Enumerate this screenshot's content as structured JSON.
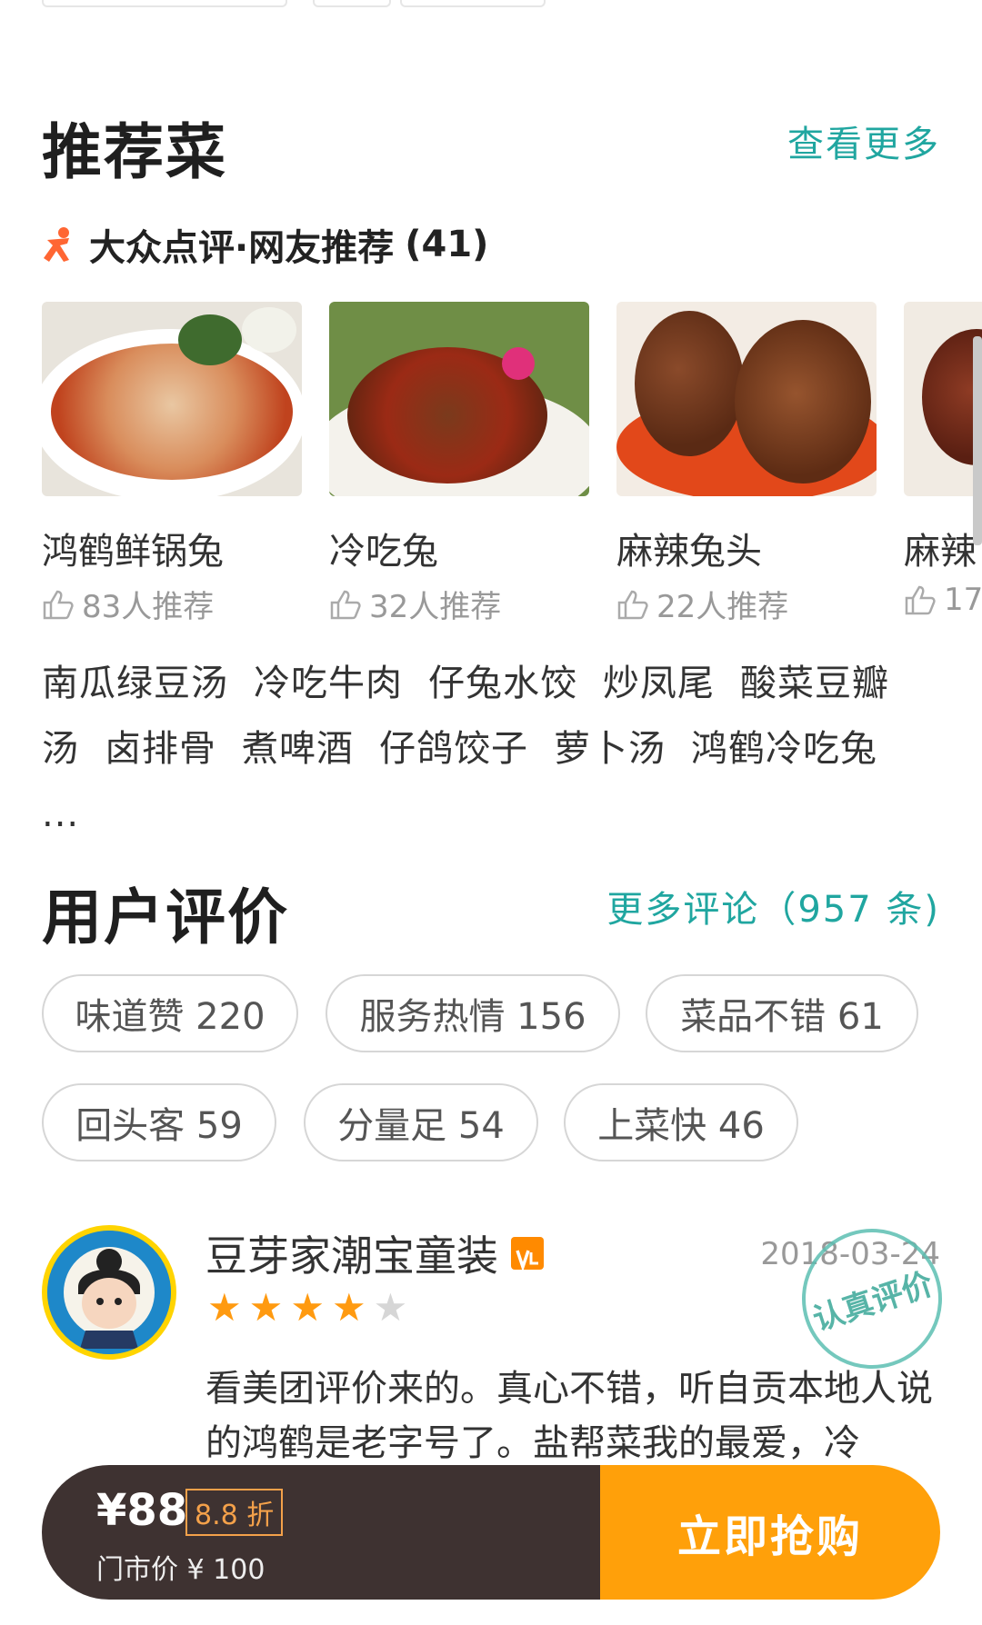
{
  "recommend": {
    "title": "推荐菜",
    "more_label": "查看更多",
    "source_label": "大众点评·网友推荐",
    "source_count": "(41)",
    "dishes": [
      {
        "name": "鸿鹤鲜锅兔",
        "likes": "83人推荐"
      },
      {
        "name": "冷吃兔",
        "likes": "32人推荐"
      },
      {
        "name": "麻辣兔头",
        "likes": "22人推荐"
      },
      {
        "name": "麻辣",
        "likes": "17"
      }
    ],
    "other_dishes": [
      "南瓜绿豆汤",
      "冷吃牛肉",
      "仔兔水饺",
      "炒凤尾",
      "酸菜豆瓣汤",
      "卤排骨",
      "煮啤酒",
      "仔鸽饺子",
      "萝卜汤",
      "鸿鹤冷吃兔 ..."
    ]
  },
  "reviews": {
    "title": "用户评价",
    "more_label": "更多评论（957 条)",
    "tags": [
      "味道赞 220",
      "服务热情 156",
      "菜品不错 61",
      "回头客 59",
      "分量足 54",
      "上菜快 46"
    ],
    "first": {
      "user": "豆芽家潮宝童装",
      "date": "2018-03-24",
      "rating": 4,
      "max_rating": 5,
      "stamp": "认真评价",
      "text": "看美团评价来的。真心不错，听自贡本地人说的鸿鹤是老字号了。盐帮菜我的最爱，冷"
    }
  },
  "buybar": {
    "price": "¥88",
    "discount": "8.8 折",
    "original": "门市价 ¥ 100",
    "button": "立即抢购"
  },
  "colors": {
    "accent": "#20a6a0",
    "buy_button": "#ffa00a",
    "buy_dark": "#3e3231",
    "star_on": "#ff9a10",
    "star_off": "#d6d6d6"
  }
}
